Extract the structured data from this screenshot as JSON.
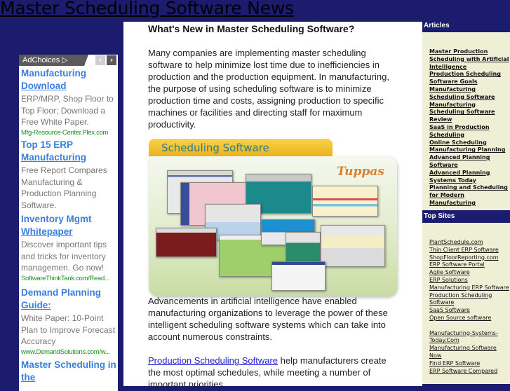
{
  "site": {
    "title": "Master Scheduling Software News"
  },
  "ads": {
    "adchoices_label": "AdChoices ▷",
    "prev_icon": "‹",
    "next_icon": "›",
    "items": [
      {
        "title_line1": "Manufacturing",
        "title_line2": "Download",
        "desc": "ERP/MRP, Shop Floor to Top Floor; Download a Free White Paper.",
        "url": "Mfg-Resource-Center.Plex.com"
      },
      {
        "title_line1": "Top 15 ERP",
        "title_line2": "Manufacturing",
        "desc": "Free Report Compares Manufacturing & Production Planning Software.",
        "url": ""
      },
      {
        "title_line1": "Inventory Mgmt",
        "title_line2": "Whitepaper",
        "desc": "Discover important tips and tricks for inventory managemen. Go now!",
        "url": "SoftwareThinkTank.com/Read..."
      },
      {
        "title_line1": "Demand Planning",
        "title_line2": "Guide:",
        "desc": "White Paper: 10-Point Plan to Improve Forecast Accuracy",
        "url": "www.DemandSolutions.com/w..."
      },
      {
        "title_line1": "Master Scheduling in",
        "title_line2": "the",
        "desc": "",
        "url": ""
      }
    ]
  },
  "main": {
    "title": "What's New in Master Scheduling Software?",
    "para1": "Many companies are implementing master scheduling software to help minimize lost time due to inefficiencies in production and the production equipment. In manufacturing, the purpose of using scheduling software is to minimize production time and costs, assigning production to specific machines or facilities and directing staff for maximum productivity.",
    "promo": {
      "tab_label": "Scheduling Software",
      "logo": "Tuppas"
    },
    "para2": "Advancements in artificial intelligence have enabled manufacturing organizations to leverage the power of these intelligent scheduling software systems which can take into account numerous constraints.",
    "para3_link": "Production Scheduling Software",
    "para3_rest": " help manufacturers create the most optimal schedules, while meeting a number of important priorities."
  },
  "sidebar": {
    "articles_header": "Articles",
    "articles": [
      "Master Production Scheduling with Artificial Intelligence",
      "Production Scheduling Software Goals",
      "Manufacturing Scheduling Software",
      "Manufacturing Scheduling Software Review",
      "SaaS in Production Scheduling",
      "Online Scheduling",
      "Manufacturing Planning",
      "Advanced Planning Software",
      "Advanced Planning Systems Today",
      "Planning and Scheduling for Modern Manufacturing"
    ],
    "topsites_header": "Top Sites",
    "topsites_group1": [
      "PlantSchedule.com",
      "Thin Client ERP Software",
      "ShopFloorReporting.com",
      "ERP Software Portal",
      "Agile Software",
      "ERP Solutions",
      "Manufacturing ERP Software",
      "Production Scheduling Software",
      "SaaS Software",
      "Open Source software"
    ],
    "topsites_group2": [
      "Manufacturing-Systems-Today.Com",
      "Manufacturing Software Now",
      "Find ERP Software",
      "ERP Software Compared"
    ]
  }
}
